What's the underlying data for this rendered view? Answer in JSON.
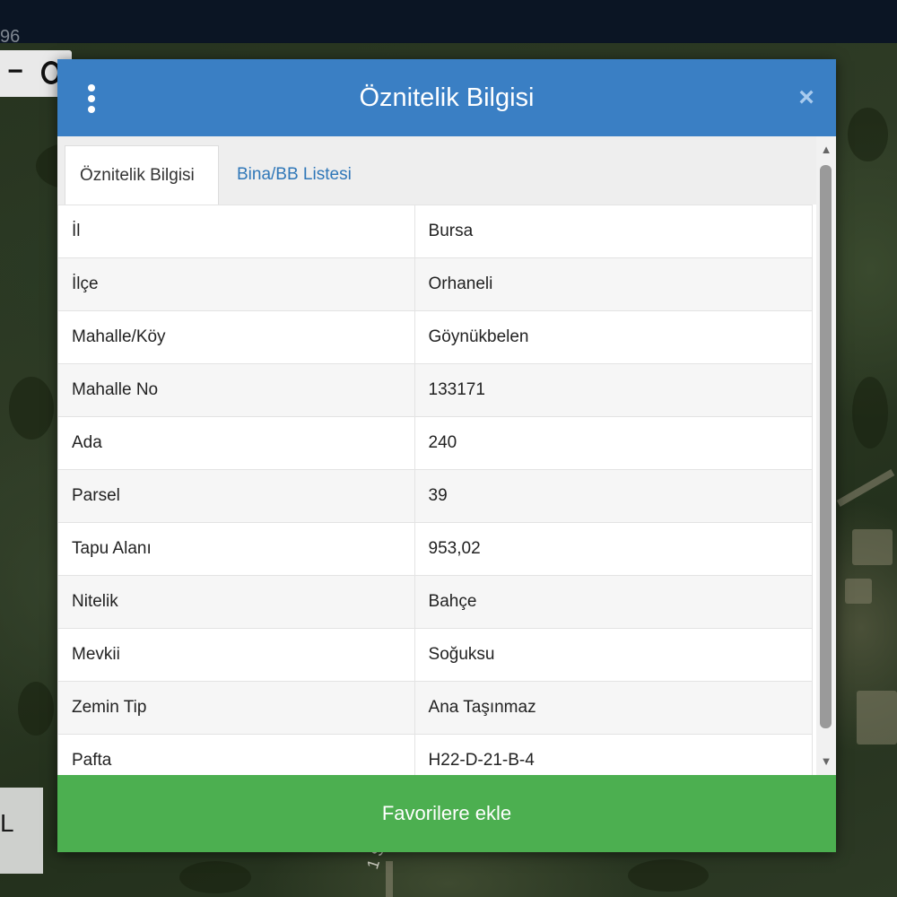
{
  "map": {
    "coord_fragment": "96",
    "zoom_out_symbol": "−",
    "scale_letter": "L",
    "street_label": "1 So"
  },
  "dialog": {
    "title": "Öznitelik Bilgisi",
    "menu_icon": "kebab-menu-icon",
    "close_symbol": "×",
    "tabs": [
      {
        "label": "Öznitelik Bilgisi",
        "active": true
      },
      {
        "label": "Bina/BB Listesi",
        "active": false
      }
    ],
    "rows": [
      {
        "key": "İl",
        "value": "Bursa"
      },
      {
        "key": "İlçe",
        "value": "Orhaneli"
      },
      {
        "key": "Mahalle/Köy",
        "value": "Göynükbelen"
      },
      {
        "key": "Mahalle No",
        "value": "133171"
      },
      {
        "key": "Ada",
        "value": "240"
      },
      {
        "key": "Parsel",
        "value": "39"
      },
      {
        "key": "Tapu Alanı",
        "value": "953,02"
      },
      {
        "key": "Nitelik",
        "value": "Bahçe"
      },
      {
        "key": "Mevkii",
        "value": "Soğuksu"
      },
      {
        "key": "Zemin Tip",
        "value": "Ana Taşınmaz"
      },
      {
        "key": "Pafta",
        "value": "H22-D-21-B-4"
      }
    ],
    "scroll_up_symbol": "▲",
    "scroll_down_symbol": "▼",
    "favorite_button_label": "Favorilere ekle"
  },
  "colors": {
    "header_blue": "#3a7fc4",
    "button_green": "#4caf50",
    "tab_link_blue": "#2f77b8"
  }
}
